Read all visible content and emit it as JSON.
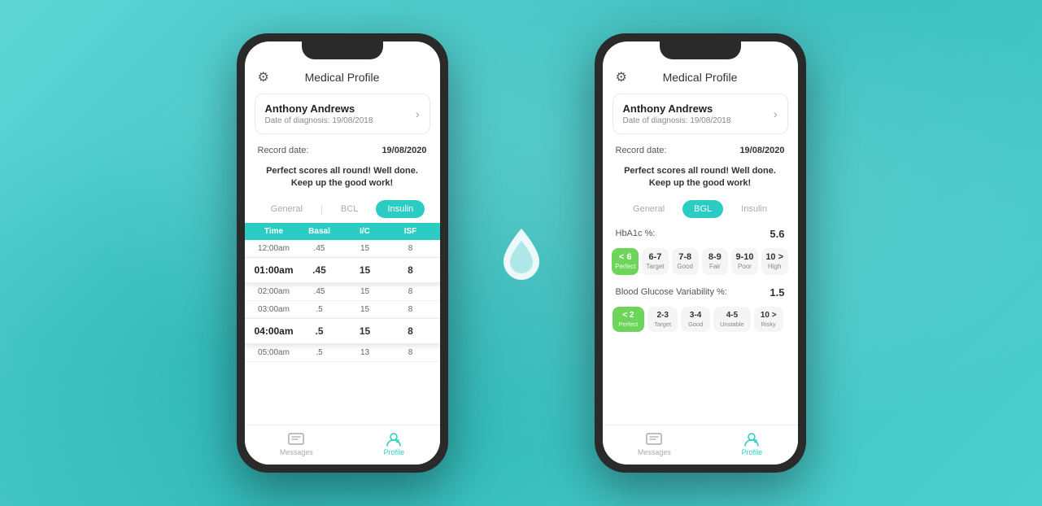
{
  "background_color": "#4dc8c8",
  "phone_left": {
    "header": {
      "title": "Medical Profile",
      "settings_icon": "⚙"
    },
    "profile": {
      "name": "Anthony Andrews",
      "diagnosis_label": "Date of diagnosis:",
      "diagnosis_date": "19/08/2018"
    },
    "record": {
      "label": "Record date:",
      "value": "19/08/2020"
    },
    "score_message_line1": "Perfect scores all round! Well done.",
    "score_message_line2": "Keep up the good work!",
    "tabs": [
      {
        "label": "General",
        "active": false
      },
      {
        "label": "BCL",
        "active": false
      },
      {
        "label": "Insulin",
        "active": true
      }
    ],
    "table": {
      "headers": [
        "Time",
        "Basal",
        "I/C",
        "ISF"
      ],
      "rows": [
        {
          "time": "12:00am",
          "basal": ".45",
          "ic": "15",
          "isf": "8",
          "highlighted": false
        },
        {
          "time": "01:00am",
          "basal": ".45",
          "ic": "15",
          "isf": "8",
          "highlighted": true
        },
        {
          "time": "02:00am",
          "basal": ".45",
          "ic": "15",
          "isf": "8",
          "highlighted": false
        },
        {
          "time": "03:00am",
          "basal": ".5",
          "ic": "15",
          "isf": "8",
          "highlighted": false
        },
        {
          "time": "04:00am",
          "basal": ".5",
          "ic": "15",
          "isf": "8",
          "highlighted": true
        },
        {
          "time": "05:00am",
          "basal": ".5",
          "ic": "13",
          "isf": "8",
          "highlighted": false
        }
      ]
    },
    "nav": {
      "messages": "Messages",
      "profile": "Profile",
      "active": "profile"
    }
  },
  "phone_right": {
    "header": {
      "title": "Medical Profile",
      "settings_icon": "⚙"
    },
    "profile": {
      "name": "Anthony Andrews",
      "diagnosis_label": "Date of diagnosis:",
      "diagnosis_date": "19/08/2018"
    },
    "record": {
      "label": "Record date:",
      "value": "19/08/2020"
    },
    "score_message_line1": "Perfect scores all round! Well done.",
    "score_message_line2": "Keep up the good work!",
    "tabs": [
      {
        "label": "General",
        "active": false
      },
      {
        "label": "BGL",
        "active": true
      },
      {
        "label": "Insulin",
        "active": false
      }
    ],
    "hba1c": {
      "label": "HbA1c %:",
      "value": "5.6"
    },
    "bgl_scores": [
      {
        "range": "< 6",
        "label": "Perfect",
        "active": true
      },
      {
        "range": "6-7",
        "label": "Target",
        "active": false
      },
      {
        "range": "7-8",
        "label": "Good",
        "active": false
      },
      {
        "range": "8-9",
        "label": "Fair",
        "active": false
      },
      {
        "range": "9-10",
        "label": "Poor",
        "active": false
      },
      {
        "range": "10 >",
        "label": "High",
        "active": false
      }
    ],
    "bgv": {
      "label": "Blood Glucose Variability %:",
      "value": "1.5"
    },
    "bgv_scores": [
      {
        "range": "< 2",
        "label": "Perfect",
        "active": true
      },
      {
        "range": "2-3",
        "label": "Target",
        "active": false
      },
      {
        "range": "3-4",
        "label": "Good",
        "active": false
      },
      {
        "range": "4-5",
        "label": "Unstable",
        "active": false
      },
      {
        "range": "10 >",
        "label": "Risky",
        "active": false
      }
    ],
    "nav": {
      "messages": "Messages",
      "profile": "Profile",
      "active": "profile"
    }
  },
  "center_drop": {
    "icon": "drop"
  }
}
